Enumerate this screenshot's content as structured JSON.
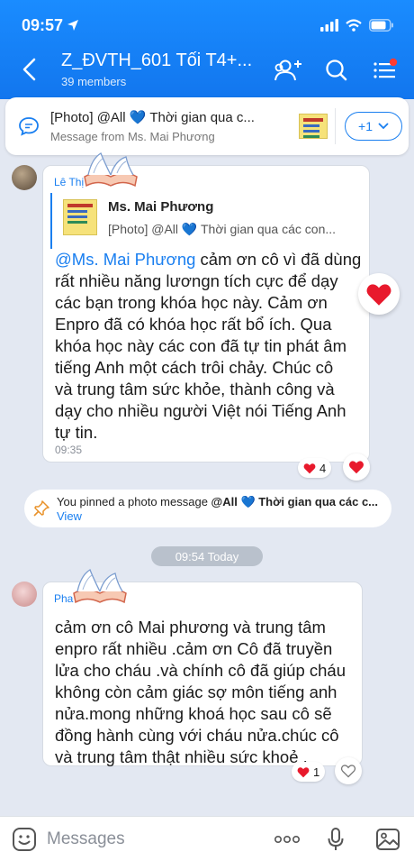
{
  "status_bar": {
    "time": "09:57"
  },
  "header": {
    "title": "Z_ĐVTH_601 Tối T4+...",
    "subtitle": "39 members"
  },
  "pinned_banner": {
    "title": "[Photo] @All 💙 Thời gian qua c...",
    "from": "Message from Ms. Mai Phương",
    "more_label": "+1"
  },
  "messages": [
    {
      "sender": "Lê Thị        n",
      "quote_name": "Ms. Mai Phương",
      "quote_text": "[Photo] @All 💙 Thời gian qua các con...",
      "mention": "@Ms. Mai Phương",
      "lines": [
        " cảm ơn cô vì đã dùng",
        "rất nhiều năng lươngn tích cực để dạy",
        "các bạn trong khóa học này. Cảm ơn",
        "Enpro đã có khóa học rất bổ ích. Qua",
        "khóa học này các con đã tự tin phát âm",
        "tiếng Anh một cách trôi chảy. Chúc cô",
        "và trung tâm sức khỏe, thành công và",
        "dạy cho nhiều người Việt nói Tiếng Anh",
        "tự tin."
      ],
      "time": "09:35",
      "reaction_count": "4"
    },
    {
      "sender": "Pha",
      "lines": [
        "cảm ơn cô Mai phương và trung tâm",
        "enpro rất nhiều .cảm ơn Cô đã truyền",
        "lửa cho cháu .và chính cô đã giúp cháu",
        "không còn cảm giác sợ môn tiếng anh",
        "nửa.mong những khoá học sau cô sẽ",
        "đồng hành cùng với cháu nửa.chúc cô",
        "và trung tâm thật nhiều sức khoẻ ."
      ],
      "reaction_count": "1"
    }
  ],
  "system_notice": {
    "text_plain": "You pinned a photo message ",
    "text_bold": "@All 💙 Thời gian qua các c...",
    "view": "View"
  },
  "date_separator": "09:54 Today",
  "composer": {
    "placeholder": "Messages"
  },
  "colors": {
    "accent": "#1a7ff0",
    "header": "#1a8cff",
    "heart": "#e8192c",
    "background": "#e3e8f2"
  }
}
